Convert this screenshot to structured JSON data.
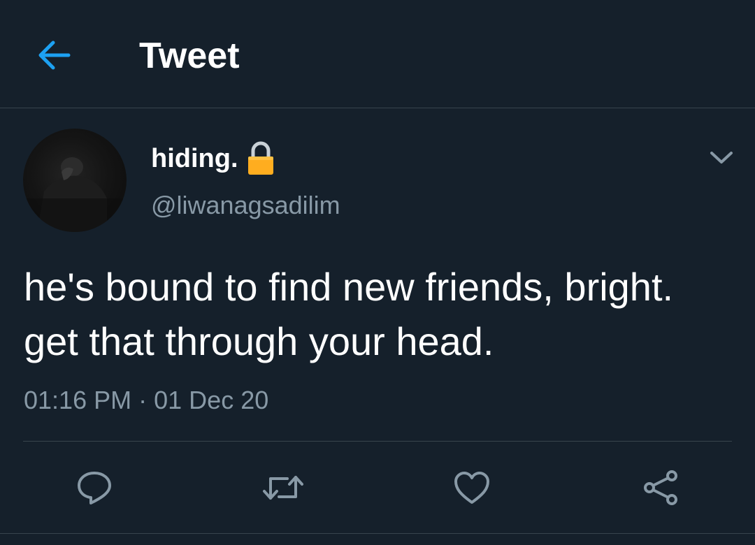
{
  "header": {
    "title": "Tweet",
    "back_icon": "arrow-left-icon"
  },
  "tweet": {
    "display_name": "hiding.",
    "handle": "@liwanagsadilim",
    "protected_icon": "lock-icon",
    "text_lines": [
      "he's bound to find new friends, bright.",
      "get that through your head."
    ],
    "time": "01:16 PM",
    "separator": "·",
    "date": "01 Dec 20"
  },
  "actions": {
    "reply_icon": "reply-icon",
    "retweet_icon": "retweet-icon",
    "like_icon": "heart-icon",
    "share_icon": "share-icon",
    "more_icon": "chevron-down-icon"
  },
  "colors": {
    "background": "#15202b",
    "accent": "#1da1f2",
    "secondary_text": "#8899a6",
    "divider": "#38444d",
    "lock": "#ffad1f"
  }
}
